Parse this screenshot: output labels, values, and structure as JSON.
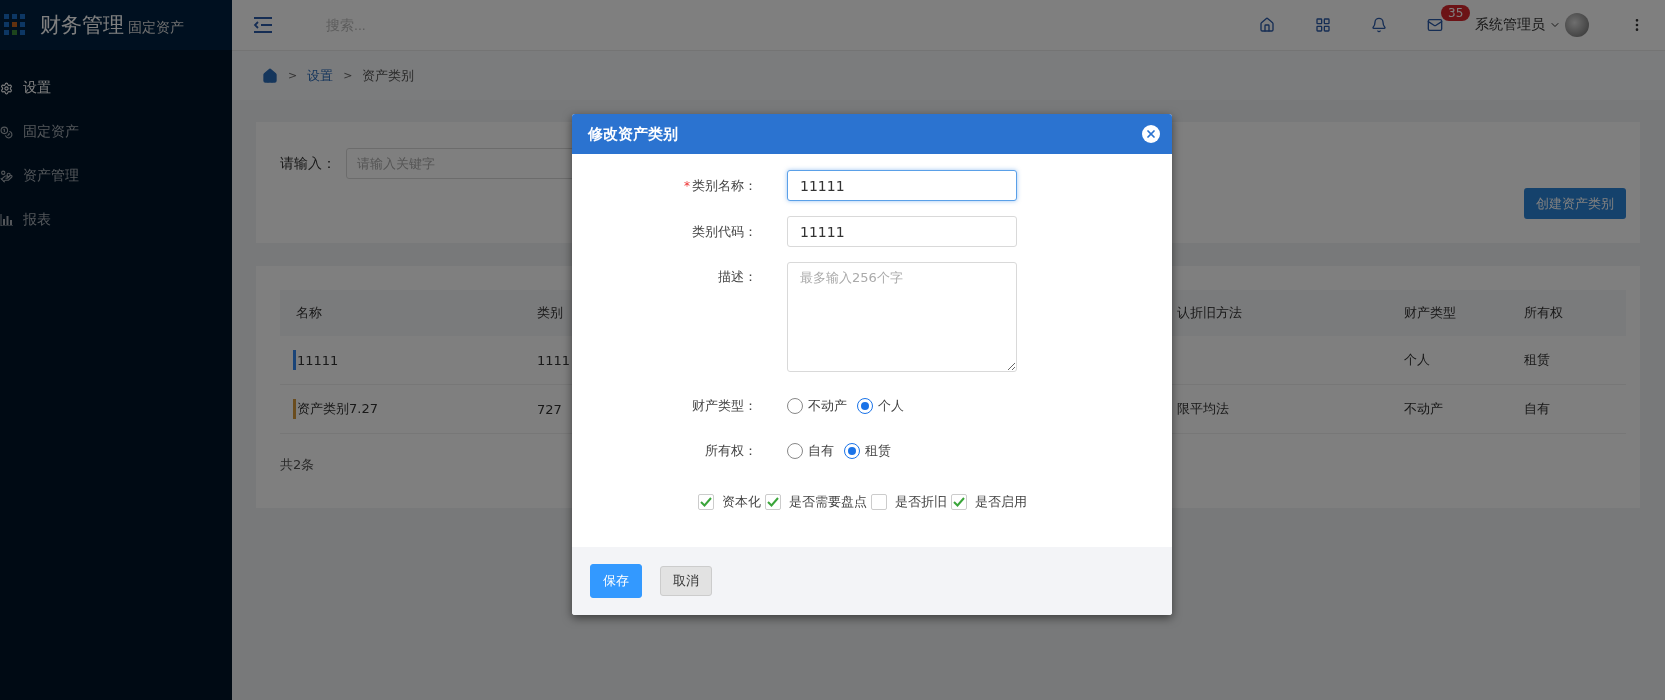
{
  "app": {
    "title": "财务管理",
    "subtitle": "固定资产"
  },
  "header": {
    "search_placeholder": "搜索...",
    "badge": "35",
    "user": "系统管理员"
  },
  "sidebar": {
    "items": [
      {
        "label": "设置",
        "selected": true,
        "kind": "settings"
      },
      {
        "label": "固定资产",
        "selected": false,
        "kind": "coins"
      },
      {
        "label": "资产管理",
        "selected": false,
        "kind": "money"
      },
      {
        "label": "报表",
        "selected": false,
        "kind": "chart"
      }
    ]
  },
  "breadcrumb": [
    {
      "separator": ">",
      "label": "设置"
    },
    {
      "separator": ">",
      "label": "资产类别"
    }
  ],
  "filter": {
    "label": "请输入：",
    "placeholder": "请输入关键字"
  },
  "create_button": "创建资产类别",
  "table": {
    "columns": [
      "名称",
      "类别",
      "认折旧方法",
      "财产类型",
      "所有权"
    ],
    "rows": [
      {
        "color": "#1a4478",
        "name": "11111",
        "code": "1111",
        "type": "个人",
        "ownership": "租赁"
      },
      {
        "color": "#6a4c1e",
        "name": "资产类别7.27",
        "code": "727",
        "depreciation": "限平均法",
        "type": "不动产",
        "ownership": "自有"
      }
    ]
  },
  "total": "共2条",
  "dialog": {
    "title": "修改资产类别",
    "fields": [
      {
        "kind": "input",
        "label": "类别名称：",
        "required_mark": "*",
        "focused": true,
        "value": "11111"
      },
      {
        "kind": "input",
        "label": "类别代码：",
        "focused": false,
        "value": "11111"
      },
      {
        "kind": "textarea",
        "label": "描述：",
        "placeholder": "最多输入256个字"
      },
      {
        "kind": "radio",
        "label": "财产类型：",
        "options": [
          {
            "label": "不动产",
            "selected": false
          },
          {
            "label": "个人",
            "selected": true
          }
        ]
      },
      {
        "kind": "radio",
        "label": "所有权：",
        "options": [
          {
            "label": "自有",
            "selected": false
          },
          {
            "label": "租赁",
            "selected": true
          }
        ]
      }
    ],
    "checkboxes": [
      {
        "label": "资本化",
        "checked": true
      },
      {
        "label": "是否需要盘点",
        "checked": true
      },
      {
        "label": "是否折旧",
        "checked": false
      },
      {
        "label": "是否启用",
        "checked": true
      }
    ],
    "buttons": [
      {
        "label": "保存",
        "kind": "primary"
      },
      {
        "label": "取消",
        "kind": "default"
      }
    ]
  }
}
